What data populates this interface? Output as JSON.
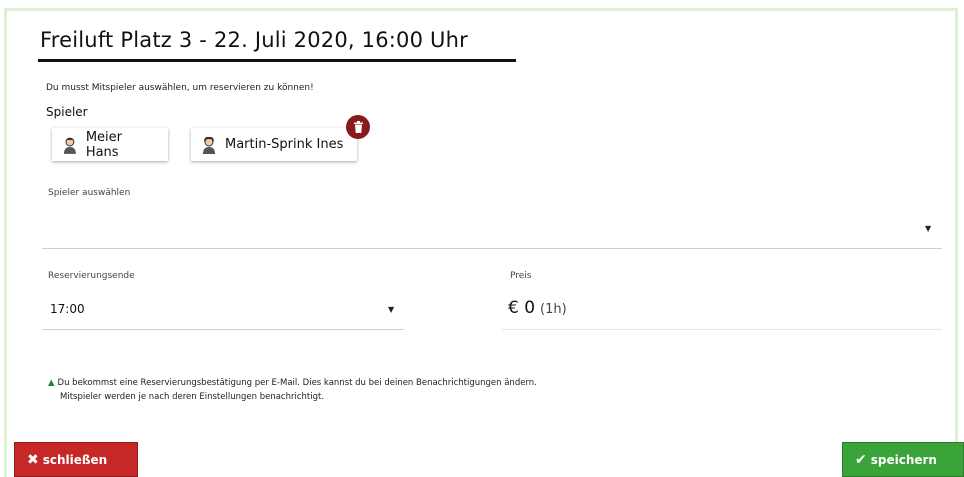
{
  "dialog": {
    "title": "Freiluft Platz 3 - 22. Juli 2020, 16:00 Uhr",
    "hint": "Du musst Mitspieler auswählen, um reservieren zu können!",
    "players_label": "Spieler"
  },
  "players": [
    {
      "name": "Meier Hans",
      "icon": "user-avatar-icon"
    },
    {
      "name": "Martin-Sprink Ines",
      "icon": "user-avatar-icon"
    }
  ],
  "player_select": {
    "label": "Spieler auswählen",
    "value": ""
  },
  "reservation_end": {
    "label": "Reservierungsende",
    "value": "17:00"
  },
  "price": {
    "label": "Preis",
    "value": "€ 0",
    "duration": "(1h)"
  },
  "notice": {
    "line1": "Du bekommst eine Reservierungsbestätigung per E-Mail. Dies kannst du bei deinen Benachrichtigungen ändern.",
    "line2": "Mitspieler werden je nach deren Einstellungen benachrichtigt."
  },
  "buttons": {
    "close": "schließen",
    "save": "speichern"
  },
  "colors": {
    "close": "#c62828",
    "save": "#3aa33a",
    "trash": "#8b1a1a",
    "notice_icon": "#2e7d32"
  }
}
